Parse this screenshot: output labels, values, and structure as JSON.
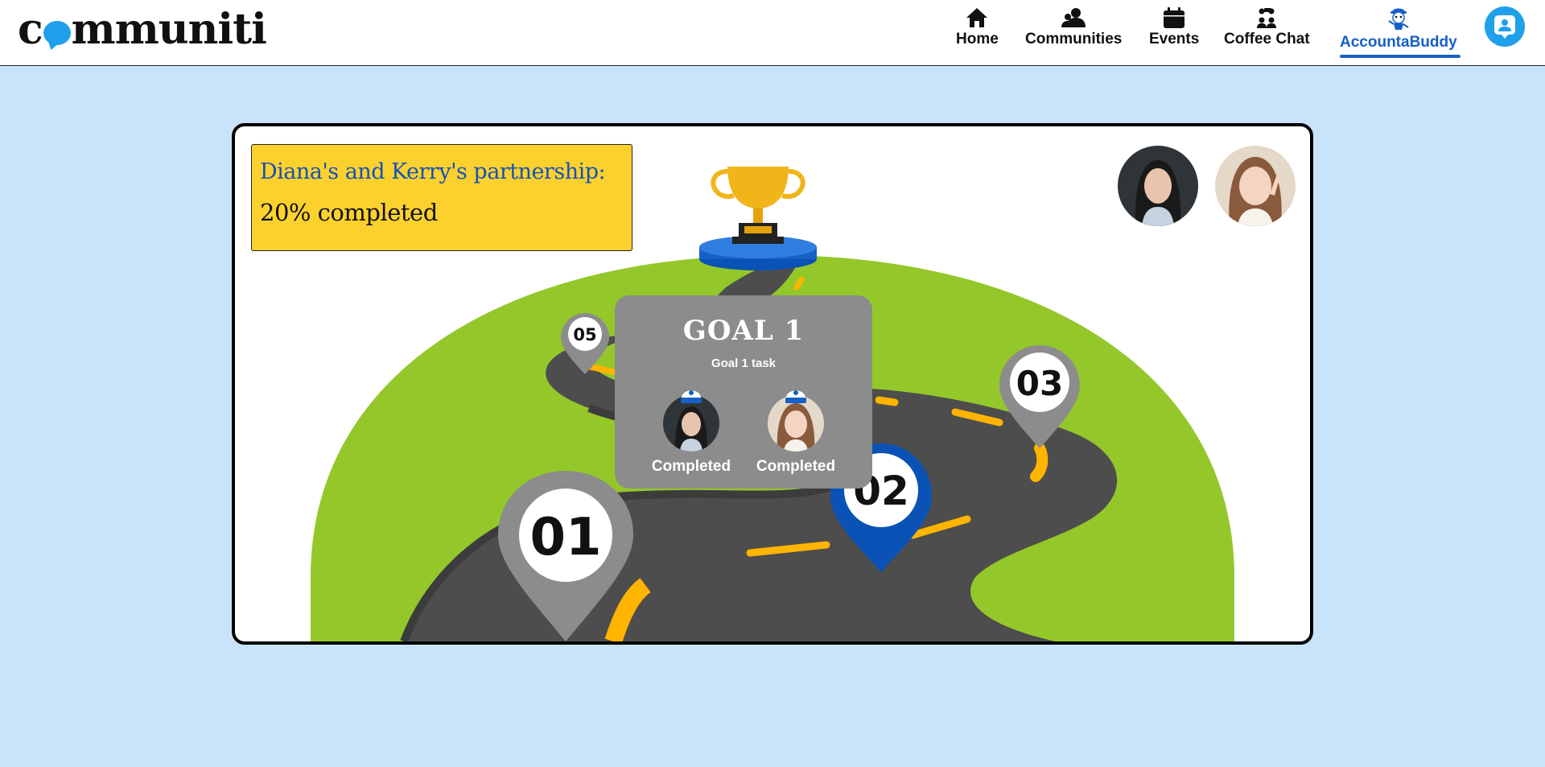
{
  "brand": {
    "logo_text_1": "c",
    "logo_text_2": "mmuniti"
  },
  "nav": {
    "home": "Home",
    "communities": "Communities",
    "events": "Events",
    "coffee_chat": "Coffee Chat",
    "accountabuddy": "AccountaBuddy",
    "active": "AccountaBuddy"
  },
  "partnership": {
    "title": "Diana's and Kerry's partnership:",
    "progress": "20% completed",
    "progress_value": 0.2
  },
  "milestones": [
    {
      "label": "01",
      "state": "inactive"
    },
    {
      "label": "02",
      "state": "current"
    },
    {
      "label": "03",
      "state": "inactive"
    },
    {
      "label": "05",
      "state": "inactive"
    }
  ],
  "goal_popup": {
    "title": "GOAL 1",
    "task": "Goal 1 task",
    "members": [
      {
        "status": "Completed"
      },
      {
        "status": "Completed"
      }
    ]
  },
  "colors": {
    "accent": "#1660c6",
    "brand_blue": "#1fa0ea",
    "background": "#c9e4fa",
    "hill": "#94c72a",
    "road": "#4d4d4d",
    "road_line": "#ffb400",
    "highlight": "#fcd12e",
    "pin_gray": "#8c8c8c",
    "pin_blue": "#0a52b5"
  }
}
